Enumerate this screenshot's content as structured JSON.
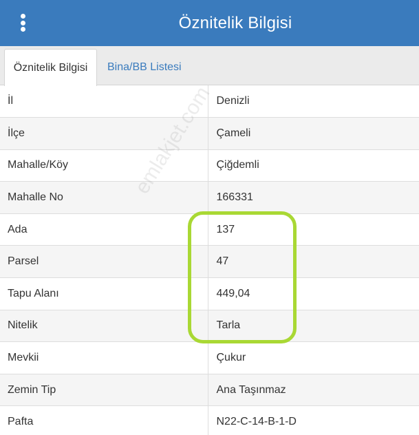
{
  "header": {
    "title": "Öznitelik Bilgisi",
    "menu_icon": "vertical-dots-icon"
  },
  "tabs": [
    {
      "label": "Öznitelik Bilgisi",
      "active": true
    },
    {
      "label": "Bina/BB Listesi",
      "active": false
    }
  ],
  "rows": [
    {
      "key": "İl",
      "value": "Denizli"
    },
    {
      "key": "İlçe",
      "value": "Çameli"
    },
    {
      "key": "Mahalle/Köy",
      "value": "Çiğdemli"
    },
    {
      "key": "Mahalle No",
      "value": "166331"
    },
    {
      "key": "Ada",
      "value": "137"
    },
    {
      "key": "Parsel",
      "value": "47"
    },
    {
      "key": "Tapu Alanı",
      "value": "449,04"
    },
    {
      "key": "Nitelik",
      "value": "Tarla"
    },
    {
      "key": "Mevkii",
      "value": "Çukur"
    },
    {
      "key": "Zemin Tip",
      "value": "Ana Taşınmaz"
    },
    {
      "key": "Pafta",
      "value": "N22-C-14-B-1-D"
    }
  ],
  "watermark": "emlakjet.com",
  "colors": {
    "header": "#3a7bbd",
    "tab_link": "#3a7bbd",
    "highlight": "#a9d834"
  }
}
